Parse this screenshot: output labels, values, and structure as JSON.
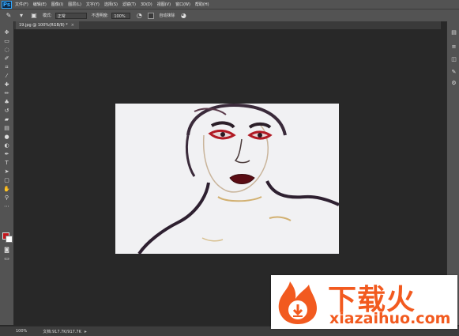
{
  "app": {
    "logo": "Ps"
  },
  "menu": [
    "文件(F)",
    "编辑(E)",
    "图像(I)",
    "图层(L)",
    "文字(Y)",
    "选择(S)",
    "滤镜(T)",
    "3D(D)",
    "视图(V)",
    "窗口(W)",
    "帮助(H)"
  ],
  "options": {
    "mode_label": "模式:",
    "mode_value": "正常",
    "opacity_label": "不透明度:",
    "opacity_value": "100%",
    "smooth_label": "自动抹除"
  },
  "document": {
    "tab_title": "19.jpg @ 100%(RGB/8) *",
    "close": "×"
  },
  "colors": {
    "foreground": "#c4151c",
    "background": "#ffffff"
  },
  "status": {
    "zoom": "100%",
    "doc_info": "文档:917.7K/917.7K",
    "arrow": "▸"
  },
  "watermark": {
    "title": "下载火",
    "url": "xiazaihuo.com",
    "brand_color": "#f25a1f"
  },
  "tools": [
    "move-icon",
    "marquee-icon",
    "lasso-icon",
    "quick-select-icon",
    "crop-icon",
    "eyedropper-icon",
    "healing-icon",
    "brush-icon",
    "stamp-icon",
    "history-brush-icon",
    "eraser-icon",
    "gradient-icon",
    "blur-icon",
    "dodge-icon",
    "pen-icon",
    "type-icon",
    "path-select-icon",
    "shape-icon",
    "hand-icon",
    "zoom-icon"
  ]
}
